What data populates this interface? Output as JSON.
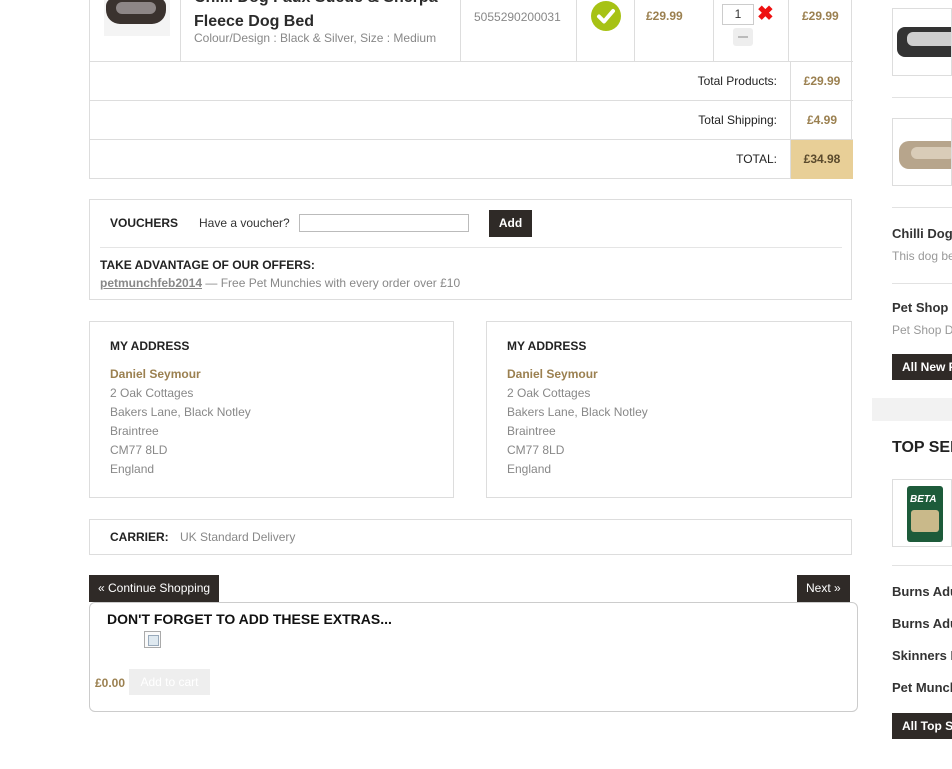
{
  "cart": {
    "product": {
      "name_line1": "Chilli Dog Faux Suede & Sherpa",
      "name_line2": "Fleece Dog Bed",
      "description": "Colour/Design : Black & Silver, Size : Medium",
      "reference": "5055290200031",
      "availability_icon": "check-icon",
      "unit_price": "£29.99",
      "quantity": "1",
      "total_price": "£29.99"
    },
    "totals": {
      "products_label": "Total Products:",
      "products_value": "£29.99",
      "shipping_label": "Total Shipping:",
      "shipping_value": "£4.99",
      "total_label": "TOTAL:",
      "total_value": "£34.98"
    }
  },
  "vouchers": {
    "title": "VOUCHERS",
    "prompt": "Have a voucher?",
    "input_value": "",
    "add_label": "Add",
    "offers_title": "TAKE ADVANTAGE OF OUR OFFERS:",
    "offer_code": "petmunchfeb2014",
    "offer_text": " — Free Pet Munchies with every order over £10"
  },
  "addresses": [
    {
      "title": "MY ADDRESS",
      "name": "Daniel Seymour",
      "lines": [
        "2 Oak Cottages",
        "Bakers Lane, Black Notley",
        "Braintree",
        "CM77 8LD",
        "England"
      ]
    },
    {
      "title": "MY ADDRESS",
      "name": "Daniel Seymour",
      "lines": [
        "2 Oak Cottages",
        "Bakers Lane, Black Notley",
        "Braintree",
        "CM77 8LD",
        "England"
      ]
    }
  ],
  "carrier": {
    "label": "CARRIER:",
    "value": "UK Standard Delivery"
  },
  "navigation": {
    "continue_label": "« Continue Shopping",
    "next_label": "Next »"
  },
  "extras": {
    "title": "DON'T FORGET TO ADD THESE EXTRAS...",
    "price": "£0.00",
    "add_to_cart_label": "Add to cart"
  },
  "sidebar": {
    "product_title": "Chilli Dog",
    "product_sub": "This dog be",
    "product2_title": "Pet Shop I",
    "product2_sub": "Pet Shop D",
    "new_button": "All New P",
    "top_heading": "TOP SEL",
    "top_items": [
      "Burns Adu",
      "Burns Adu",
      "Skinners F",
      "Pet Munch"
    ],
    "top_button": "All Top Se"
  },
  "colors": {
    "accent_gold": "#9b8050",
    "total_highlight": "#e8cf97",
    "dark_button": "#2f2a27",
    "availability_green": "#a7c214",
    "remove_red": "#ee1111"
  }
}
